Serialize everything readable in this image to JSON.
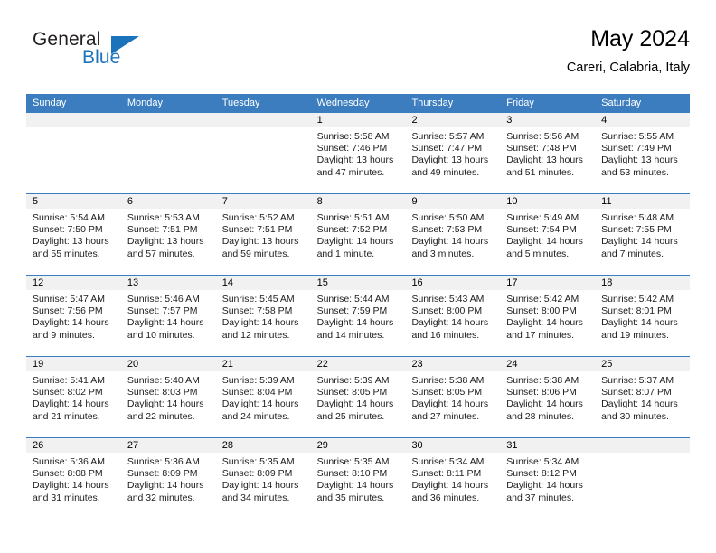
{
  "brand": {
    "name_part1": "General",
    "name_part2": "Blue"
  },
  "header": {
    "title": "May 2024",
    "location": "Careri, Calabria, Italy"
  },
  "colors": {
    "header_blue": "#3b7dbf",
    "brand_blue": "#1b74bb",
    "date_strip_gray": "#f1f1f1"
  },
  "weekdays": [
    "Sunday",
    "Monday",
    "Tuesday",
    "Wednesday",
    "Thursday",
    "Friday",
    "Saturday"
  ],
  "weeks": [
    [
      {
        "date": "",
        "sunrise": "",
        "sunset": "",
        "daylight_line1": "",
        "daylight_line2": ""
      },
      {
        "date": "",
        "sunrise": "",
        "sunset": "",
        "daylight_line1": "",
        "daylight_line2": ""
      },
      {
        "date": "",
        "sunrise": "",
        "sunset": "",
        "daylight_line1": "",
        "daylight_line2": ""
      },
      {
        "date": "1",
        "sunrise": "Sunrise: 5:58 AM",
        "sunset": "Sunset: 7:46 PM",
        "daylight_line1": "Daylight: 13 hours",
        "daylight_line2": "and 47 minutes."
      },
      {
        "date": "2",
        "sunrise": "Sunrise: 5:57 AM",
        "sunset": "Sunset: 7:47 PM",
        "daylight_line1": "Daylight: 13 hours",
        "daylight_line2": "and 49 minutes."
      },
      {
        "date": "3",
        "sunrise": "Sunrise: 5:56 AM",
        "sunset": "Sunset: 7:48 PM",
        "daylight_line1": "Daylight: 13 hours",
        "daylight_line2": "and 51 minutes."
      },
      {
        "date": "4",
        "sunrise": "Sunrise: 5:55 AM",
        "sunset": "Sunset: 7:49 PM",
        "daylight_line1": "Daylight: 13 hours",
        "daylight_line2": "and 53 minutes."
      }
    ],
    [
      {
        "date": "5",
        "sunrise": "Sunrise: 5:54 AM",
        "sunset": "Sunset: 7:50 PM",
        "daylight_line1": "Daylight: 13 hours",
        "daylight_line2": "and 55 minutes."
      },
      {
        "date": "6",
        "sunrise": "Sunrise: 5:53 AM",
        "sunset": "Sunset: 7:51 PM",
        "daylight_line1": "Daylight: 13 hours",
        "daylight_line2": "and 57 minutes."
      },
      {
        "date": "7",
        "sunrise": "Sunrise: 5:52 AM",
        "sunset": "Sunset: 7:51 PM",
        "daylight_line1": "Daylight: 13 hours",
        "daylight_line2": "and 59 minutes."
      },
      {
        "date": "8",
        "sunrise": "Sunrise: 5:51 AM",
        "sunset": "Sunset: 7:52 PM",
        "daylight_line1": "Daylight: 14 hours",
        "daylight_line2": "and 1 minute."
      },
      {
        "date": "9",
        "sunrise": "Sunrise: 5:50 AM",
        "sunset": "Sunset: 7:53 PM",
        "daylight_line1": "Daylight: 14 hours",
        "daylight_line2": "and 3 minutes."
      },
      {
        "date": "10",
        "sunrise": "Sunrise: 5:49 AM",
        "sunset": "Sunset: 7:54 PM",
        "daylight_line1": "Daylight: 14 hours",
        "daylight_line2": "and 5 minutes."
      },
      {
        "date": "11",
        "sunrise": "Sunrise: 5:48 AM",
        "sunset": "Sunset: 7:55 PM",
        "daylight_line1": "Daylight: 14 hours",
        "daylight_line2": "and 7 minutes."
      }
    ],
    [
      {
        "date": "12",
        "sunrise": "Sunrise: 5:47 AM",
        "sunset": "Sunset: 7:56 PM",
        "daylight_line1": "Daylight: 14 hours",
        "daylight_line2": "and 9 minutes."
      },
      {
        "date": "13",
        "sunrise": "Sunrise: 5:46 AM",
        "sunset": "Sunset: 7:57 PM",
        "daylight_line1": "Daylight: 14 hours",
        "daylight_line2": "and 10 minutes."
      },
      {
        "date": "14",
        "sunrise": "Sunrise: 5:45 AM",
        "sunset": "Sunset: 7:58 PM",
        "daylight_line1": "Daylight: 14 hours",
        "daylight_line2": "and 12 minutes."
      },
      {
        "date": "15",
        "sunrise": "Sunrise: 5:44 AM",
        "sunset": "Sunset: 7:59 PM",
        "daylight_line1": "Daylight: 14 hours",
        "daylight_line2": "and 14 minutes."
      },
      {
        "date": "16",
        "sunrise": "Sunrise: 5:43 AM",
        "sunset": "Sunset: 8:00 PM",
        "daylight_line1": "Daylight: 14 hours",
        "daylight_line2": "and 16 minutes."
      },
      {
        "date": "17",
        "sunrise": "Sunrise: 5:42 AM",
        "sunset": "Sunset: 8:00 PM",
        "daylight_line1": "Daylight: 14 hours",
        "daylight_line2": "and 17 minutes."
      },
      {
        "date": "18",
        "sunrise": "Sunrise: 5:42 AM",
        "sunset": "Sunset: 8:01 PM",
        "daylight_line1": "Daylight: 14 hours",
        "daylight_line2": "and 19 minutes."
      }
    ],
    [
      {
        "date": "19",
        "sunrise": "Sunrise: 5:41 AM",
        "sunset": "Sunset: 8:02 PM",
        "daylight_line1": "Daylight: 14 hours",
        "daylight_line2": "and 21 minutes."
      },
      {
        "date": "20",
        "sunrise": "Sunrise: 5:40 AM",
        "sunset": "Sunset: 8:03 PM",
        "daylight_line1": "Daylight: 14 hours",
        "daylight_line2": "and 22 minutes."
      },
      {
        "date": "21",
        "sunrise": "Sunrise: 5:39 AM",
        "sunset": "Sunset: 8:04 PM",
        "daylight_line1": "Daylight: 14 hours",
        "daylight_line2": "and 24 minutes."
      },
      {
        "date": "22",
        "sunrise": "Sunrise: 5:39 AM",
        "sunset": "Sunset: 8:05 PM",
        "daylight_line1": "Daylight: 14 hours",
        "daylight_line2": "and 25 minutes."
      },
      {
        "date": "23",
        "sunrise": "Sunrise: 5:38 AM",
        "sunset": "Sunset: 8:05 PM",
        "daylight_line1": "Daylight: 14 hours",
        "daylight_line2": "and 27 minutes."
      },
      {
        "date": "24",
        "sunrise": "Sunrise: 5:38 AM",
        "sunset": "Sunset: 8:06 PM",
        "daylight_line1": "Daylight: 14 hours",
        "daylight_line2": "and 28 minutes."
      },
      {
        "date": "25",
        "sunrise": "Sunrise: 5:37 AM",
        "sunset": "Sunset: 8:07 PM",
        "daylight_line1": "Daylight: 14 hours",
        "daylight_line2": "and 30 minutes."
      }
    ],
    [
      {
        "date": "26",
        "sunrise": "Sunrise: 5:36 AM",
        "sunset": "Sunset: 8:08 PM",
        "daylight_line1": "Daylight: 14 hours",
        "daylight_line2": "and 31 minutes."
      },
      {
        "date": "27",
        "sunrise": "Sunrise: 5:36 AM",
        "sunset": "Sunset: 8:09 PM",
        "daylight_line1": "Daylight: 14 hours",
        "daylight_line2": "and 32 minutes."
      },
      {
        "date": "28",
        "sunrise": "Sunrise: 5:35 AM",
        "sunset": "Sunset: 8:09 PM",
        "daylight_line1": "Daylight: 14 hours",
        "daylight_line2": "and 34 minutes."
      },
      {
        "date": "29",
        "sunrise": "Sunrise: 5:35 AM",
        "sunset": "Sunset: 8:10 PM",
        "daylight_line1": "Daylight: 14 hours",
        "daylight_line2": "and 35 minutes."
      },
      {
        "date": "30",
        "sunrise": "Sunrise: 5:34 AM",
        "sunset": "Sunset: 8:11 PM",
        "daylight_line1": "Daylight: 14 hours",
        "daylight_line2": "and 36 minutes."
      },
      {
        "date": "31",
        "sunrise": "Sunrise: 5:34 AM",
        "sunset": "Sunset: 8:12 PM",
        "daylight_line1": "Daylight: 14 hours",
        "daylight_line2": "and 37 minutes."
      },
      {
        "date": "",
        "sunrise": "",
        "sunset": "",
        "daylight_line1": "",
        "daylight_line2": ""
      }
    ]
  ]
}
